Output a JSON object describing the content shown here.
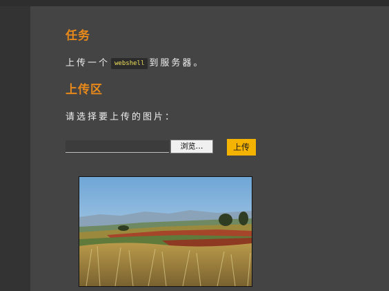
{
  "task": {
    "heading": "任务",
    "text_before": "上传一个",
    "code": "webshell",
    "text_after": "到服务器。"
  },
  "upload": {
    "heading": "上传区",
    "prompt": "请选择要上传的图片：",
    "file_value": "",
    "browse_label": "浏览…",
    "submit_label": "上传"
  },
  "preview": {
    "description_icon": "landscape-image"
  },
  "colors": {
    "background": "#333333",
    "panel": "#444444",
    "heading": "#e8891a",
    "accent_button": "#f5b301",
    "code_text": "#f2e15a"
  }
}
